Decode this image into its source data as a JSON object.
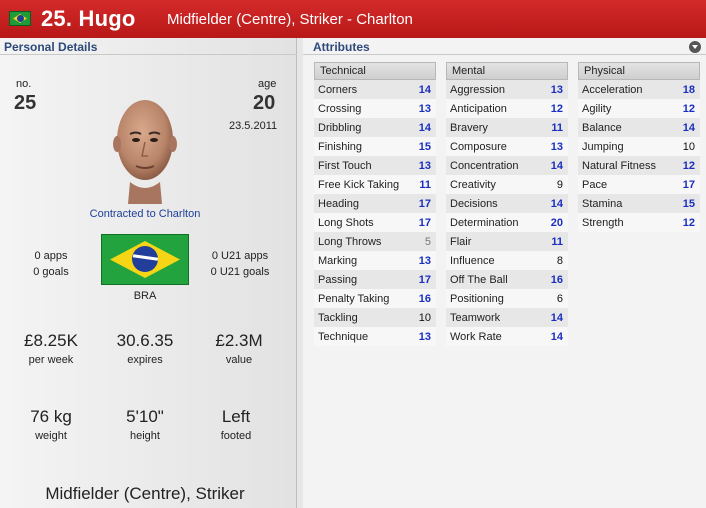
{
  "header": {
    "name": "25. Hugo",
    "positions": "Midfielder (Centre), Striker - Charlton",
    "nation_flag": "brazil-flag-icon"
  },
  "personal": {
    "section_title": "Personal Details",
    "no_label": "no.",
    "no_value": "25",
    "age_label": "age",
    "age_value": "20",
    "dob": "23.5.2011",
    "contract": "Contracted to Charlton",
    "apps": "0 apps",
    "goals": "0 goals",
    "u21_apps": "0 U21 apps",
    "u21_goals": "0 U21 goals",
    "nation": "BRA",
    "wage_value": "£8.25K",
    "wage_label": "per week",
    "expires_value": "30.6.35",
    "expires_label": "expires",
    "value_value": "£2.3M",
    "value_label": "value",
    "weight_value": "76 kg",
    "weight_label": "weight",
    "height_value": "5'10\"",
    "height_label": "height",
    "foot_value": "Left",
    "foot_label": "footed",
    "positions_text": "Midfielder (Centre), Striker"
  },
  "attributes": {
    "section_title": "Attributes",
    "columns": [
      {
        "title": "Technical",
        "items": [
          {
            "name": "Corners",
            "value": "14",
            "tone": "blue"
          },
          {
            "name": "Crossing",
            "value": "13",
            "tone": "blue"
          },
          {
            "name": "Dribbling",
            "value": "14",
            "tone": "blue"
          },
          {
            "name": "Finishing",
            "value": "15",
            "tone": "blue"
          },
          {
            "name": "First Touch",
            "value": "13",
            "tone": "blue"
          },
          {
            "name": "Free Kick Taking",
            "value": "11",
            "tone": "blue"
          },
          {
            "name": "Heading",
            "value": "17",
            "tone": "blue"
          },
          {
            "name": "Long Shots",
            "value": "17",
            "tone": "blue"
          },
          {
            "name": "Long Throws",
            "value": "5",
            "tone": "grey"
          },
          {
            "name": "Marking",
            "value": "13",
            "tone": "blue"
          },
          {
            "name": "Passing",
            "value": "17",
            "tone": "blue"
          },
          {
            "name": "Penalty Taking",
            "value": "16",
            "tone": "blue"
          },
          {
            "name": "Tackling",
            "value": "10",
            "tone": "blk"
          },
          {
            "name": "Technique",
            "value": "13",
            "tone": "blue"
          }
        ]
      },
      {
        "title": "Mental",
        "items": [
          {
            "name": "Aggression",
            "value": "13",
            "tone": "blue"
          },
          {
            "name": "Anticipation",
            "value": "12",
            "tone": "blue"
          },
          {
            "name": "Bravery",
            "value": "11",
            "tone": "blue"
          },
          {
            "name": "Composure",
            "value": "13",
            "tone": "blue"
          },
          {
            "name": "Concentration",
            "value": "14",
            "tone": "blue"
          },
          {
            "name": "Creativity",
            "value": "9",
            "tone": "blk"
          },
          {
            "name": "Decisions",
            "value": "14",
            "tone": "blue"
          },
          {
            "name": "Determination",
            "value": "20",
            "tone": "blue"
          },
          {
            "name": "Flair",
            "value": "11",
            "tone": "blue"
          },
          {
            "name": "Influence",
            "value": "8",
            "tone": "blk"
          },
          {
            "name": "Off The Ball",
            "value": "16",
            "tone": "blue"
          },
          {
            "name": "Positioning",
            "value": "6",
            "tone": "blk"
          },
          {
            "name": "Teamwork",
            "value": "14",
            "tone": "blue"
          },
          {
            "name": "Work Rate",
            "value": "14",
            "tone": "blue"
          }
        ]
      },
      {
        "title": "Physical",
        "items": [
          {
            "name": "Acceleration",
            "value": "18",
            "tone": "blue"
          },
          {
            "name": "Agility",
            "value": "12",
            "tone": "blue"
          },
          {
            "name": "Balance",
            "value": "14",
            "tone": "blue"
          },
          {
            "name": "Jumping",
            "value": "10",
            "tone": "blk"
          },
          {
            "name": "Natural Fitness",
            "value": "12",
            "tone": "blue"
          },
          {
            "name": "Pace",
            "value": "17",
            "tone": "blue"
          },
          {
            "name": "Stamina",
            "value": "15",
            "tone": "blue"
          },
          {
            "name": "Strength",
            "value": "12",
            "tone": "blue"
          }
        ]
      }
    ]
  }
}
